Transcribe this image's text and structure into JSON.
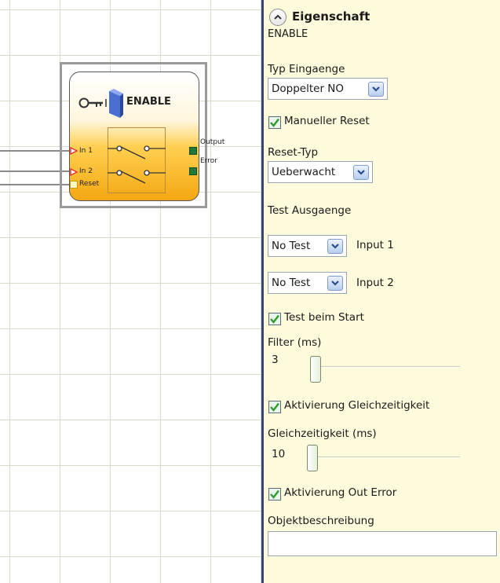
{
  "block": {
    "title": "ENABLE",
    "inputs": [
      "In 1",
      "In 2",
      "Reset"
    ],
    "outputs": [
      "Output",
      "Error"
    ],
    "icon": "key-switch-icon"
  },
  "panel": {
    "title": "Eigenschaft",
    "subtitle": "ENABLE",
    "typ_eingaenge_label": "Typ Eingaenge",
    "typ_eingaenge_value": "Doppelter NO",
    "manueller_reset_label": "Manueller Reset",
    "manueller_reset_checked": true,
    "reset_typ_label": "Reset-Typ",
    "reset_typ_value": "Ueberwacht",
    "test_ausgaenge_label": "Test Ausgaenge",
    "test_1_value": "No Test",
    "test_1_label": "Input 1",
    "test_2_value": "No Test",
    "test_2_label": "Input 2",
    "test_beim_start_label": "Test beim Start",
    "test_beim_start_checked": true,
    "filter_label": "Filter (ms)",
    "filter_value": "3",
    "aktivierung_gleichzeitigkeit_label": "Aktivierung Gleichzeitigkeit",
    "aktivierung_gleichzeitigkeit_checked": true,
    "gleichzeitigkeit_label": "Gleichzeitigkeit (ms)",
    "gleichzeitigkeit_value": "10",
    "aktivierung_out_error_label": "Aktivierung Out Error",
    "aktivierung_out_error_checked": true,
    "objektbeschreibung_label": "Objektbeschreibung",
    "objektbeschreibung_value": ""
  },
  "colors": {
    "panel_bg": "#fefbdc",
    "block_orange": "#f4a712",
    "port_green": "#1e7a3a",
    "port_red": "#e53030",
    "checkbox_check": "#2f9a2f"
  }
}
